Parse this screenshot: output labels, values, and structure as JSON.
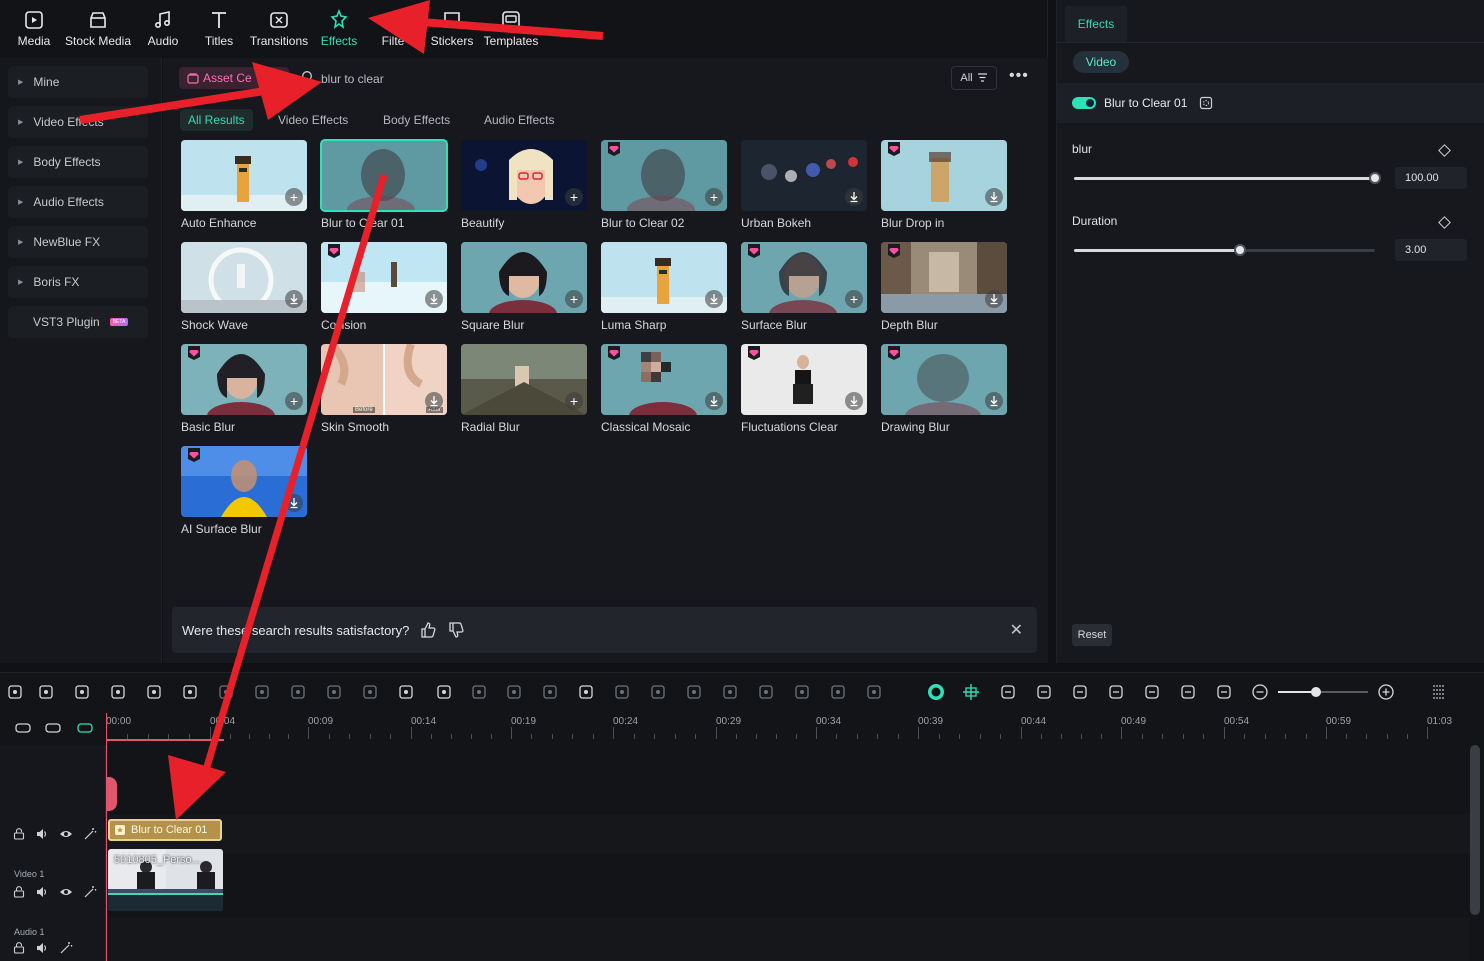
{
  "top_tabs": [
    {
      "label": "Media",
      "icon": "media-icon"
    },
    {
      "label": "Stock Media",
      "icon": "stock-media-icon"
    },
    {
      "label": "Audio",
      "icon": "audio-icon"
    },
    {
      "label": "Titles",
      "icon": "titles-icon"
    },
    {
      "label": "Transitions",
      "icon": "transitions-icon"
    },
    {
      "label": "Effects",
      "icon": "effects-icon",
      "active": true
    },
    {
      "label": "Filte",
      "icon": "filters-icon"
    },
    {
      "label": "Stickers",
      "icon": "stickers-icon"
    },
    {
      "label": "Templates",
      "icon": "templates-icon"
    }
  ],
  "sidebar": {
    "items": [
      {
        "label": "Mine"
      },
      {
        "label": "Video Effects"
      },
      {
        "label": "Body Effects"
      },
      {
        "label": "Audio Effects"
      },
      {
        "label": "NewBlue FX"
      },
      {
        "label": "Boris FX"
      },
      {
        "label": "VST3 Plugin",
        "badge": "BETA"
      }
    ]
  },
  "search": {
    "asset_center_label": "Asset Ce",
    "query": "blur to clear",
    "filter_label": "All"
  },
  "filter_tabs": [
    "All Results",
    "Video Effects",
    "Body Effects",
    "Audio Effects"
  ],
  "results": [
    {
      "label": "Auto Enhance",
      "theme": "lighthouse",
      "premium": false,
      "action": "add"
    },
    {
      "label": "Blur to Clear 01",
      "theme": "blur-portrait",
      "premium": false,
      "action": "none",
      "selected": true
    },
    {
      "label": "Beautify",
      "theme": "beautify",
      "premium": false,
      "action": "add"
    },
    {
      "label": "Blur to Clear 02",
      "theme": "blur-portrait",
      "premium": true,
      "action": "add"
    },
    {
      "label": "Urban Bokeh",
      "theme": "bokeh",
      "premium": false,
      "action": "download"
    },
    {
      "label": "Blur Drop in",
      "theme": "lighthouse-blur",
      "premium": true,
      "action": "download"
    },
    {
      "label": "Shock Wave",
      "theme": "shockwave",
      "premium": false,
      "action": "download"
    },
    {
      "label": "Collision",
      "theme": "collision",
      "premium": true,
      "action": "download"
    },
    {
      "label": "Square Blur",
      "theme": "portrait",
      "premium": false,
      "action": "add"
    },
    {
      "label": "Luma Sharp",
      "theme": "lighthouse",
      "premium": false,
      "action": "download"
    },
    {
      "label": "Surface Blur",
      "theme": "portrait-blur",
      "premium": true,
      "action": "add"
    },
    {
      "label": "Depth Blur",
      "theme": "city",
      "premium": true,
      "action": "download"
    },
    {
      "label": "Basic Blur",
      "theme": "portrait-soft",
      "premium": true,
      "action": "add"
    },
    {
      "label": "Skin Smooth",
      "theme": "skin",
      "premium": false,
      "action": "download",
      "before_label": "Before",
      "after_label": "After"
    },
    {
      "label": "Radial Blur",
      "theme": "radial",
      "premium": false,
      "action": "add"
    },
    {
      "label": "Classical Mosaic",
      "theme": "mosaic",
      "premium": true,
      "action": "download"
    },
    {
      "label": "Fluctuations Clear",
      "theme": "fashion",
      "premium": true,
      "action": "download"
    },
    {
      "label": "Drawing Blur",
      "theme": "drawing",
      "premium": true,
      "action": "download"
    },
    {
      "label": "AI Surface Blur",
      "theme": "ai-surface",
      "premium": true,
      "action": "download"
    }
  ],
  "feedback": {
    "prompt": "Were these search results satisfactory?"
  },
  "right_panel": {
    "tab": "Effects",
    "category_pill": "Video",
    "effect_name": "Blur to Clear 01",
    "params": [
      {
        "label": "blur",
        "value": "100.00",
        "fraction": 1.0
      },
      {
        "label": "Duration",
        "value": "3.00",
        "fraction": 0.55
      }
    ],
    "reset_label": "Reset"
  },
  "timeline": {
    "zoom_fraction": 0.42,
    "ruler_labels": [
      "00:00",
      "00:04",
      "00:09",
      "00:14",
      "00:19",
      "00:24",
      "00:29",
      "00:34",
      "00:39",
      "00:44",
      "00:49",
      "00:54",
      "00:59",
      "01:03"
    ],
    "tracks": {
      "video_label": "Video 1",
      "audio_label": "Audio 1"
    },
    "effect_clip_label": "Blur to Clear 01",
    "video_clip_label": "5010805_Perso..."
  },
  "colors": {
    "accent": "#2fe0b8",
    "premium": "#ff4fa3",
    "playhead": "#e0566c",
    "annotation": "#e8202a",
    "effect_clip": "#b5924a"
  }
}
